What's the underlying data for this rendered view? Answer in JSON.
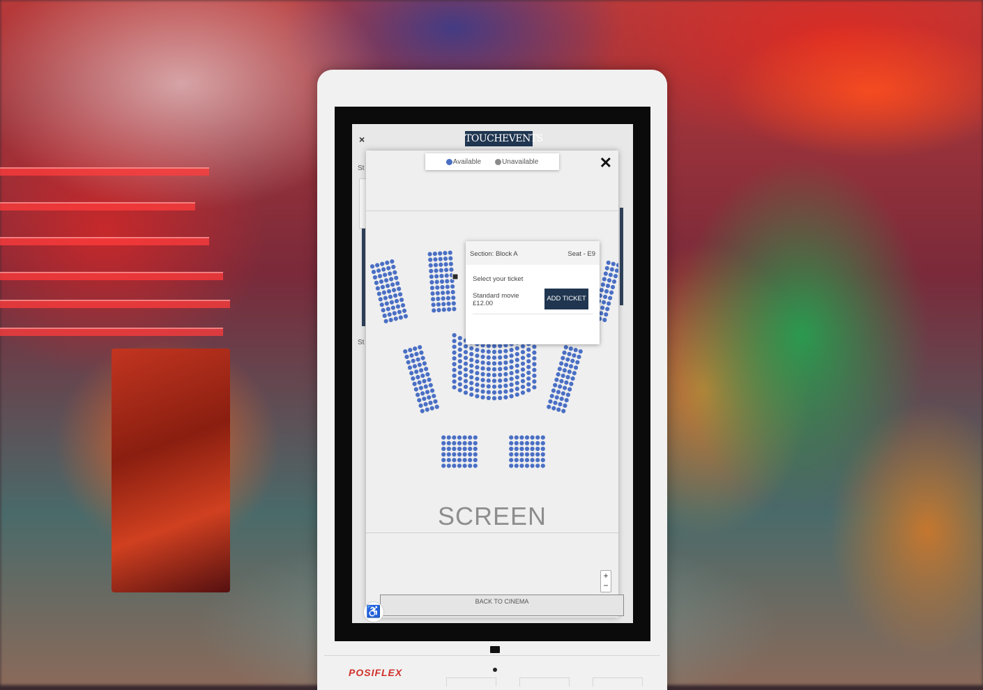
{
  "app": {
    "brand": "TOUCHEVENTS"
  },
  "background_screen": {
    "close_icon": "×",
    "label_top": "St",
    "label_mid": "St"
  },
  "legend": {
    "available_label": "Available",
    "unavailable_label": "Unavailable",
    "available_color": "#4a6fc4",
    "unavailable_color": "#8a8a8a"
  },
  "modal": {
    "close_icon": "✕"
  },
  "popup": {
    "section": "Section: Block A",
    "seat": "Seat - E9",
    "select_label": "Select your ticket",
    "ticket_name": "Standard movie",
    "ticket_price": "£12.00",
    "add_button": "ADD TICKET"
  },
  "screen_label": "SCREEN",
  "zoom": {
    "in": "+",
    "out": "−"
  },
  "back_button": "BACK TO CINEMA",
  "accessibility_icon": "♿",
  "kiosk_brand": "POSIFLEX",
  "colors": {
    "seat": "#4a6fc4",
    "brand_bg": "#1f3550"
  }
}
